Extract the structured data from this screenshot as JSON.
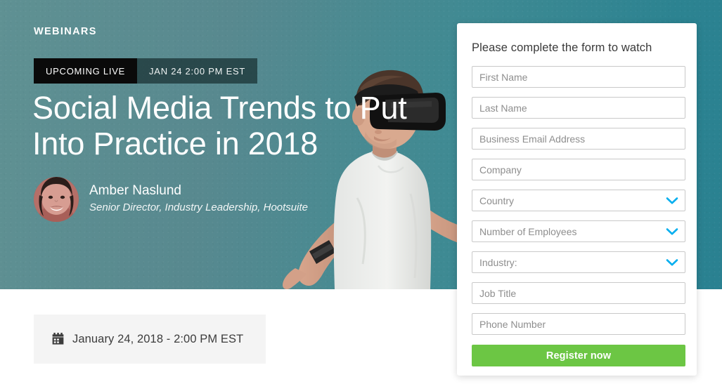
{
  "hero": {
    "eyebrow": "WEBINARS",
    "badge": {
      "status_label": "UPCOMING LIVE",
      "time_label": "JAN 24 2:00 PM EST"
    },
    "title": "Social Media Trends to Put Into Practice in 2018",
    "speaker": {
      "name": "Amber Naslund",
      "role": "Senior Director, Industry Leadership, Hootsuite",
      "avatar_alt": "Amber Naslund headshot"
    },
    "person_image_alt": "Man wearing a virtual reality headset",
    "colors": {
      "gradient_left": "#5f9193",
      "gradient_right": "#2a8191"
    }
  },
  "schedule": {
    "icon": "calendar-icon",
    "date_text": "January 24, 2018 - 2:00 PM EST"
  },
  "form": {
    "heading": "Please complete the form to watch",
    "fields": [
      {
        "name": "first-name",
        "placeholder": "First Name",
        "value": "",
        "type": "text"
      },
      {
        "name": "last-name",
        "placeholder": "Last Name",
        "value": "",
        "type": "text"
      },
      {
        "name": "business-email",
        "placeholder": "Business Email Address",
        "value": "",
        "type": "text"
      },
      {
        "name": "company",
        "placeholder": "Company",
        "value": "",
        "type": "text"
      },
      {
        "name": "country",
        "placeholder": "Country",
        "value": "",
        "type": "select"
      },
      {
        "name": "number-of-employees",
        "placeholder": "Number of Employees",
        "value": "",
        "type": "select"
      },
      {
        "name": "industry",
        "placeholder": "Industry:",
        "value": "",
        "type": "select"
      },
      {
        "name": "job-title",
        "placeholder": "Job Title",
        "value": "",
        "type": "text"
      },
      {
        "name": "phone-number",
        "placeholder": "Phone Number",
        "value": "",
        "type": "text"
      }
    ],
    "submit_label": "Register now",
    "colors": {
      "submit_bg": "#6cc644",
      "chevron": "#00aeef",
      "border": "#c9c9c9"
    }
  }
}
